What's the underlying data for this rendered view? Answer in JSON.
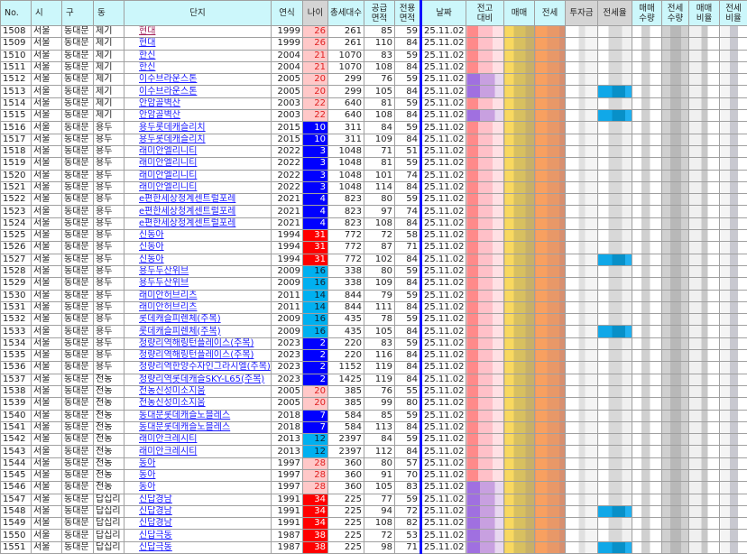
{
  "headers": {
    "no": "No.",
    "si": "시",
    "gu": "구",
    "dong": "동",
    "danji": "단지",
    "year": "연식",
    "age": "나이",
    "households": "총세대수",
    "supply_area": "공급\n면적",
    "exclusive_area": "전용\n면적",
    "date": "날짜",
    "vs_prev_high": "전고\n대비",
    "sale": "매매",
    "jeonse": "전세",
    "investment": "투자금",
    "jeonse_ratio": "전세율",
    "sale_count": "매매\n수량",
    "jeonse_count": "전세\n수량",
    "sale_rate": "매매\n비율",
    "jeonse_rate": "전세\n비율"
  },
  "colors": {
    "age_blue": "#0000ff",
    "age_cyan": "#00b0f0",
    "age_pink": "#ffc8c8",
    "age_red": "#ff0000",
    "divider": "#1010ff",
    "header_bg": "#ccf7fb"
  },
  "rows": [
    [
      "1508",
      "서울",
      "동대문",
      "제기",
      "현대",
      "1999",
      "26",
      "261",
      "85",
      "59",
      "25.11.02"
    ],
    [
      "1509",
      "서울",
      "동대문",
      "제기",
      "현대",
      "1999",
      "26",
      "261",
      "110",
      "84",
      "25.11.02"
    ],
    [
      "1510",
      "서울",
      "동대문",
      "제기",
      "한신",
      "2004",
      "21",
      "1070",
      "83",
      "59",
      "25.11.02"
    ],
    [
      "1511",
      "서울",
      "동대문",
      "제기",
      "한신",
      "2004",
      "21",
      "1070",
      "108",
      "84",
      "25.11.02"
    ],
    [
      "1512",
      "서울",
      "동대문",
      "제기",
      "이수브라운스톤",
      "2005",
      "20",
      "299",
      "76",
      "59",
      "25.11.02"
    ],
    [
      "1513",
      "서울",
      "동대문",
      "제기",
      "이수브라운스톤",
      "2005",
      "20",
      "299",
      "105",
      "84",
      "25.11.02"
    ],
    [
      "1514",
      "서울",
      "동대문",
      "제기",
      "안암골벽산",
      "2003",
      "22",
      "640",
      "81",
      "59",
      "25.11.02"
    ],
    [
      "1515",
      "서울",
      "동대문",
      "제기",
      "안암골벽산",
      "2003",
      "22",
      "640",
      "108",
      "84",
      "25.11.02"
    ],
    [
      "1516",
      "서울",
      "동대문",
      "용두",
      "용두롯데캐슬리치",
      "2015",
      "10",
      "311",
      "84",
      "59",
      "25.11.02"
    ],
    [
      "1517",
      "서울",
      "동대문",
      "용두",
      "용두롯데캐슬리치",
      "2015",
      "10",
      "311",
      "109",
      "84",
      "25.11.02"
    ],
    [
      "1518",
      "서울",
      "동대문",
      "용두",
      "래미안엘리니티",
      "2022",
      "3",
      "1048",
      "71",
      "51",
      "25.11.02"
    ],
    [
      "1519",
      "서울",
      "동대문",
      "용두",
      "래미안엘리니티",
      "2022",
      "3",
      "1048",
      "81",
      "59",
      "25.11.02"
    ],
    [
      "1520",
      "서울",
      "동대문",
      "용두",
      "래미안엘리니티",
      "2022",
      "3",
      "1048",
      "101",
      "74",
      "25.11.02"
    ],
    [
      "1521",
      "서울",
      "동대문",
      "용두",
      "래미안엘리니티",
      "2022",
      "3",
      "1048",
      "114",
      "84",
      "25.11.02"
    ],
    [
      "1522",
      "서울",
      "동대문",
      "용두",
      "e편한세상청계센트럴포레",
      "2021",
      "4",
      "823",
      "80",
      "59",
      "25.11.02"
    ],
    [
      "1523",
      "서울",
      "동대문",
      "용두",
      "e편한세상청계센트럴포레",
      "2021",
      "4",
      "823",
      "97",
      "74",
      "25.11.02"
    ],
    [
      "1524",
      "서울",
      "동대문",
      "용두",
      "e편한세상청계센트럴포레",
      "2021",
      "4",
      "823",
      "108",
      "84",
      "25.11.02"
    ],
    [
      "1525",
      "서울",
      "동대문",
      "용두",
      "신동아",
      "1994",
      "31",
      "772",
      "72",
      "58",
      "25.11.02"
    ],
    [
      "1526",
      "서울",
      "동대문",
      "용두",
      "신동아",
      "1994",
      "31",
      "772",
      "87",
      "71",
      "25.11.02"
    ],
    [
      "1527",
      "서울",
      "동대문",
      "용두",
      "신동아",
      "1994",
      "31",
      "772",
      "102",
      "84",
      "25.11.02"
    ],
    [
      "1528",
      "서울",
      "동대문",
      "용두",
      "용두두산위브",
      "2009",
      "16",
      "338",
      "80",
      "59",
      "25.11.02"
    ],
    [
      "1529",
      "서울",
      "동대문",
      "용두",
      "용두두산위브",
      "2009",
      "16",
      "338",
      "109",
      "84",
      "25.11.02"
    ],
    [
      "1530",
      "서울",
      "동대문",
      "용두",
      "래미안허브리츠",
      "2011",
      "14",
      "844",
      "79",
      "59",
      "25.11.02"
    ],
    [
      "1531",
      "서울",
      "동대문",
      "용두",
      "래미안허브리츠",
      "2011",
      "14",
      "844",
      "111",
      "84",
      "25.11.02"
    ],
    [
      "1532",
      "서울",
      "동대문",
      "용두",
      "롯데캐슬피렌체(주복)",
      "2009",
      "16",
      "435",
      "78",
      "59",
      "25.11.02"
    ],
    [
      "1533",
      "서울",
      "동대문",
      "용두",
      "롯데캐슬피렌체(주복)",
      "2009",
      "16",
      "435",
      "105",
      "84",
      "25.11.02"
    ],
    [
      "1534",
      "서울",
      "동대문",
      "용두",
      "청량리역해링턴플레이스(주복)",
      "2023",
      "2",
      "220",
      "83",
      "59",
      "25.11.02"
    ],
    [
      "1535",
      "서울",
      "동대문",
      "용두",
      "청량리역해링턴플레이스(주복)",
      "2023",
      "2",
      "220",
      "116",
      "84",
      "25.11.02"
    ],
    [
      "1536",
      "서울",
      "동대문",
      "용두",
      "청량리역한양수자인그라시엘(주복)",
      "2023",
      "2",
      "1152",
      "119",
      "84",
      "25.11.02"
    ],
    [
      "1537",
      "서울",
      "동대문",
      "전농",
      "청량리역롯데캐슬SKY-L65(주복)",
      "2023",
      "2",
      "1425",
      "119",
      "84",
      "25.11.02"
    ],
    [
      "1538",
      "서울",
      "동대문",
      "전농",
      "전농신성미소지움",
      "2005",
      "20",
      "385",
      "76",
      "55",
      "25.11.02"
    ],
    [
      "1539",
      "서울",
      "동대문",
      "전농",
      "전농신성미소지움",
      "2005",
      "20",
      "385",
      "99",
      "80",
      "25.11.02"
    ],
    [
      "1540",
      "서울",
      "동대문",
      "전농",
      "동대문롯데캐슬노블레스",
      "2018",
      "7",
      "584",
      "85",
      "59",
      "25.11.02"
    ],
    [
      "1541",
      "서울",
      "동대문",
      "전농",
      "동대문롯데캐슬노블레스",
      "2018",
      "7",
      "584",
      "113",
      "84",
      "25.11.02"
    ],
    [
      "1542",
      "서울",
      "동대문",
      "전농",
      "래미안크레시티",
      "2013",
      "12",
      "2397",
      "84",
      "59",
      "25.11.02"
    ],
    [
      "1543",
      "서울",
      "동대문",
      "전농",
      "래미안크레시티",
      "2013",
      "12",
      "2397",
      "112",
      "84",
      "25.11.02"
    ],
    [
      "1544",
      "서울",
      "동대문",
      "전농",
      "동아",
      "1997",
      "28",
      "360",
      "80",
      "57",
      "25.11.02"
    ],
    [
      "1545",
      "서울",
      "동대문",
      "전농",
      "동아",
      "1997",
      "28",
      "360",
      "91",
      "70",
      "25.11.02"
    ],
    [
      "1546",
      "서울",
      "동대문",
      "전농",
      "동아",
      "1997",
      "28",
      "360",
      "105",
      "83",
      "25.11.02"
    ],
    [
      "1547",
      "서울",
      "동대문",
      "답십리",
      "신답경남",
      "1991",
      "34",
      "225",
      "77",
      "59",
      "25.11.02"
    ],
    [
      "1548",
      "서울",
      "동대문",
      "답십리",
      "신답경남",
      "1991",
      "34",
      "225",
      "94",
      "72",
      "25.11.02"
    ],
    [
      "1549",
      "서울",
      "동대문",
      "답십리",
      "신답경남",
      "1991",
      "34",
      "225",
      "108",
      "82",
      "25.11.02"
    ],
    [
      "1550",
      "서울",
      "동대문",
      "답십리",
      "신답극동",
      "1987",
      "38",
      "225",
      "72",
      "53",
      "25.11.02"
    ],
    [
      "1551",
      "서울",
      "동대문",
      "답십리",
      "신답극동",
      "1987",
      "38",
      "225",
      "98",
      "71",
      "25.11.02"
    ]
  ]
}
